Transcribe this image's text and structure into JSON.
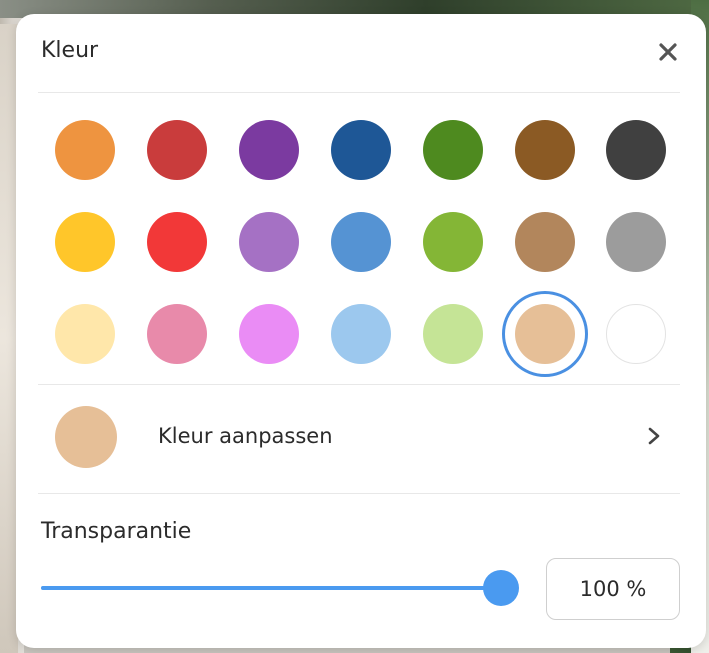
{
  "dialog": {
    "title": "Kleur",
    "close_icon": "close-icon"
  },
  "palette": {
    "rows": [
      [
        {
          "name": "orange",
          "color": "#EE9440"
        },
        {
          "name": "red-dark",
          "color": "#C93C3C"
        },
        {
          "name": "purple-dark",
          "color": "#7B3AA0"
        },
        {
          "name": "blue-dark",
          "color": "#1E5796"
        },
        {
          "name": "green-dark",
          "color": "#4E8A1F"
        },
        {
          "name": "brown-dark",
          "color": "#8B5A24"
        },
        {
          "name": "gray-dark",
          "color": "#404040"
        }
      ],
      [
        {
          "name": "yellow",
          "color": "#FFC62A"
        },
        {
          "name": "red",
          "color": "#F23838"
        },
        {
          "name": "purple",
          "color": "#A571C4"
        },
        {
          "name": "blue",
          "color": "#5593D3"
        },
        {
          "name": "green",
          "color": "#84B636"
        },
        {
          "name": "brown",
          "color": "#B2865C"
        },
        {
          "name": "gray",
          "color": "#9C9C9C"
        }
      ],
      [
        {
          "name": "yellow-light",
          "color": "#FFE7AA"
        },
        {
          "name": "pink",
          "color": "#E88AAA"
        },
        {
          "name": "magenta-light",
          "color": "#EA8CF5"
        },
        {
          "name": "blue-light",
          "color": "#9CC8EE"
        },
        {
          "name": "green-light",
          "color": "#C5E496"
        },
        {
          "name": "beige",
          "color": "#E6BF97"
        },
        {
          "name": "white",
          "color": "#FFFFFF"
        }
      ]
    ],
    "selected": {
      "row": 2,
      "col": 5
    },
    "selection_ring_color": "#4A90E2"
  },
  "custom_color": {
    "label": "Kleur aanpassen",
    "preview_color": "#E6BF97",
    "chevron_icon": "chevron-right-icon"
  },
  "transparency": {
    "label": "Transparantie",
    "value": 100,
    "value_text": "100 %",
    "accent_color": "#4A9AF0"
  }
}
